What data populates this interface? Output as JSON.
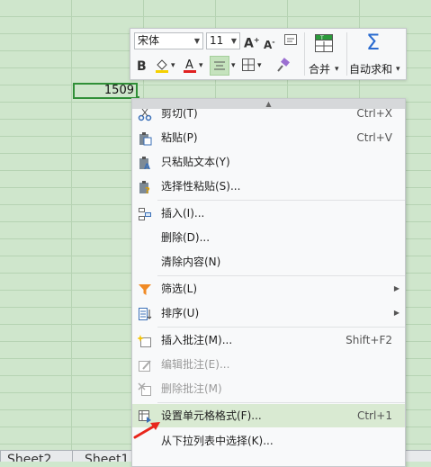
{
  "cell": {
    "value": "1509"
  },
  "sheet_tabs": [
    "Sheet2",
    "Sheet1"
  ],
  "mini_toolbar": {
    "font_name": "宋体",
    "font_size": "11",
    "merge_label": "合并",
    "autosum_label": "自动求和",
    "icons": [
      "grow-font-icon",
      "shrink-font-icon",
      "clear-format-icon",
      "bold-icon",
      "fill-color-icon",
      "font-color-icon",
      "align-center-icon",
      "borders-icon",
      "format-painter-icon",
      "merge-icon",
      "autosum-icon"
    ],
    "colors": {
      "fill": "#f5d000",
      "font": "#e02020",
      "merge": "#2a9a3a",
      "autosum": "#2a6bd0"
    }
  },
  "context_menu": {
    "items": [
      {
        "label": "剪切(T)",
        "shortcut": "Ctrl+X",
        "icon": "scissors-icon"
      },
      {
        "label": "粘贴(P)",
        "shortcut": "Ctrl+V",
        "icon": "paste-icon"
      },
      {
        "label": "只粘贴文本(Y)",
        "shortcut": "",
        "icon": "paste-text-icon"
      },
      {
        "label": "选择性粘贴(S)...",
        "shortcut": "",
        "icon": "paste-special-icon"
      },
      {
        "label": "插入(I)...",
        "shortcut": "",
        "icon": "insert-icon"
      },
      {
        "label": "删除(D)...",
        "shortcut": "",
        "icon": ""
      },
      {
        "label": "清除内容(N)",
        "shortcut": "",
        "icon": ""
      },
      {
        "label": "筛选(L)",
        "shortcut": "",
        "icon": "filter-icon"
      },
      {
        "label": "排序(U)",
        "shortcut": "",
        "icon": "sort-icon"
      },
      {
        "label": "插入批注(M)...",
        "shortcut": "Shift+F2",
        "icon": "insert-comment-icon"
      },
      {
        "label": "编辑批注(E)...",
        "shortcut": "",
        "icon": "edit-comment-icon"
      },
      {
        "label": "删除批注(M)",
        "shortcut": "",
        "icon": "delete-comment-icon"
      },
      {
        "label": "设置单元格格式(F)...",
        "shortcut": "Ctrl+1",
        "icon": "format-cells-icon"
      },
      {
        "label": "从下拉列表中选择(K)...",
        "shortcut": "",
        "icon": ""
      }
    ]
  }
}
